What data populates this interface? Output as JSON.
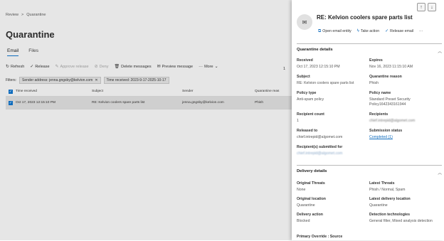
{
  "breadcrumb": {
    "root": "Review",
    "sep": ">",
    "current": "Quarantine"
  },
  "page_title": "Quarantine",
  "tabs": [
    {
      "label": "Email"
    },
    {
      "label": "Files"
    }
  ],
  "toolbar": {
    "refresh": "Refresh",
    "release": "Release",
    "approve": "Approve release",
    "deny": "Deny",
    "delete": "Delete messages",
    "preview": "Preview message",
    "more": "More"
  },
  "filters": {
    "label": "Filters:",
    "sender": "Sender address: jenna.gngsby@kelvion.com",
    "time": "Time received: 2023-9-17-2025-10-17"
  },
  "table": {
    "headers": {
      "time": "Time received",
      "subject": "Subject",
      "sender": "Sender",
      "reason": "Quarantine reas"
    },
    "rows": [
      {
        "time": "Oct 17, 2023 12:15:10 PM",
        "subject": "RE: Kelvion coolers spare parts list",
        "sender": "jenna.gngsby@kelvion.com",
        "reason": "Phish"
      }
    ]
  },
  "side_char": "1",
  "panel": {
    "title": "RE: Kelvion coolers spare parts list",
    "actions": {
      "open": "Open email entity",
      "take": "Take action",
      "release": "Release email",
      "more": "···"
    },
    "quarantine": {
      "header": "Quarantine details",
      "received_label": "Received",
      "received": "Oct 17, 2023 12:15:10 PM",
      "expires_label": "Expires",
      "expires": "Nov 16, 2023 11:15:10 AM",
      "subject_label": "Subject",
      "subject": "RE: Kelvion coolers spare parts list",
      "reason_label": "Quarantine reason",
      "reason": "Phish",
      "policy_type_label": "Policy type",
      "policy_type": "Anti-spam policy",
      "policy_name_label": "Policy name",
      "policy_name": "Standard Preset Security Policy1642343161944",
      "count_label": "Recipient count",
      "count": "1",
      "recipients_label": "Recipients",
      "recipients": "chief.intrepid@algomet.com",
      "released_label": "Released to",
      "released": "chief.intrepid@algomet.com",
      "submission_label": "Submission status",
      "submission": "Completed (1)",
      "submitted_label": "Recipient(s) submitted for",
      "submitted": "chief.intrepid@algomet.com"
    },
    "delivery": {
      "header": "Delivery details",
      "orig_threats_label": "Original Threats",
      "orig_threats": "None",
      "latest_threats_label": "Latest Threats",
      "latest_threats": "Phish / Normal, Spam",
      "orig_loc_label": "Original location",
      "orig_loc": "Quarantine",
      "latest_loc_label": "Latest delivery location",
      "latest_loc": "Quarantine",
      "action_label": "Delivery action",
      "action": "Blocked",
      "tech_label": "Detection technologies",
      "tech": "General filter, Mixed analysis detection",
      "override_label": "Primary Override : Source"
    }
  }
}
